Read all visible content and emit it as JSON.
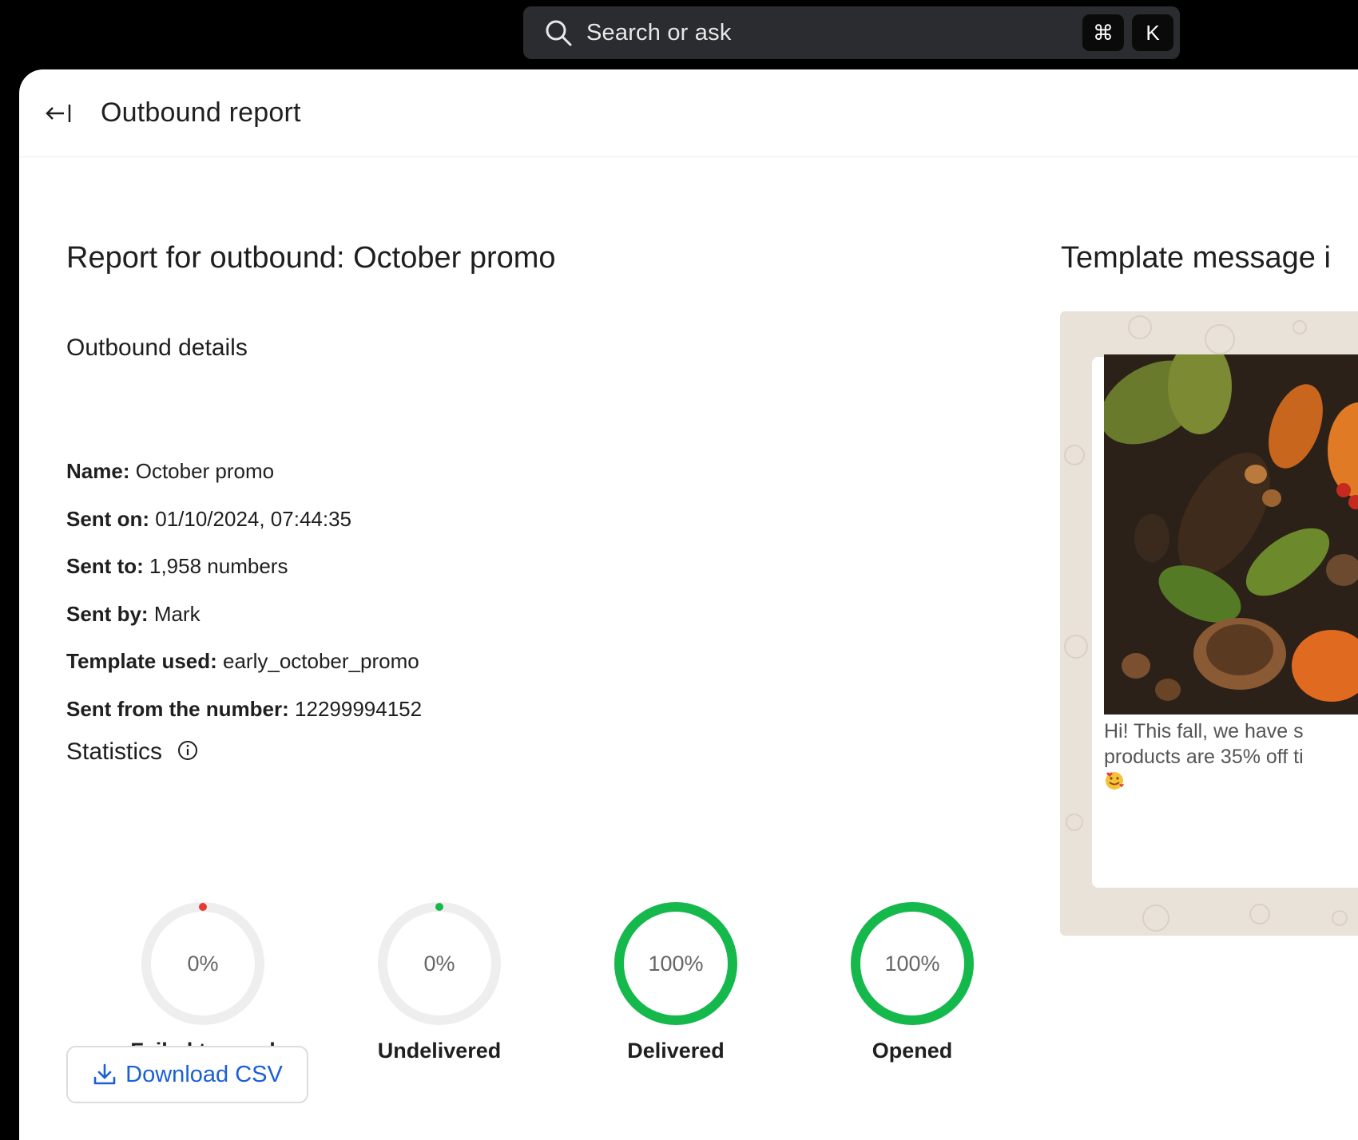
{
  "search": {
    "placeholder": "Search or ask",
    "shortcut_cmd": "⌘",
    "shortcut_key": "K"
  },
  "header": {
    "title": "Outbound report"
  },
  "report": {
    "title": "Report for outbound: October promo",
    "details_heading": "Outbound details",
    "details": [
      {
        "label": "Name:",
        "value": "October promo"
      },
      {
        "label": "Sent on:",
        "value": "01/10/2024, 07:44:35"
      },
      {
        "label": "Sent to:",
        "value": "1,958 numbers"
      },
      {
        "label": "Sent by:",
        "value": "Mark"
      },
      {
        "label": "Template used:",
        "value": "early_october_promo"
      },
      {
        "label": "Sent from the number:",
        "value": "12299994152"
      }
    ],
    "statistics_heading": "Statistics",
    "stats": [
      {
        "label": "Failed to send",
        "percent_text": "0%",
        "fraction": 0,
        "color": "#e53935"
      },
      {
        "label": "Undelivered",
        "percent_text": "0%",
        "fraction": 0,
        "color": "#14b84b"
      },
      {
        "label": "Delivered",
        "percent_text": "100%",
        "fraction": 1,
        "color": "#14b84b"
      },
      {
        "label": "Opened",
        "percent_text": "100%",
        "fraction": 1,
        "color": "#14b84b"
      }
    ],
    "download_label": "Download CSV"
  },
  "template": {
    "title": "Template message i",
    "text_line1": "Hi! This fall, we have s",
    "text_line2": "products are 35% off ti"
  },
  "colors": {
    "accent_blue": "#1a5fd6",
    "success": "#14b84b",
    "danger": "#e53935",
    "ring_track": "#eeeeee"
  }
}
